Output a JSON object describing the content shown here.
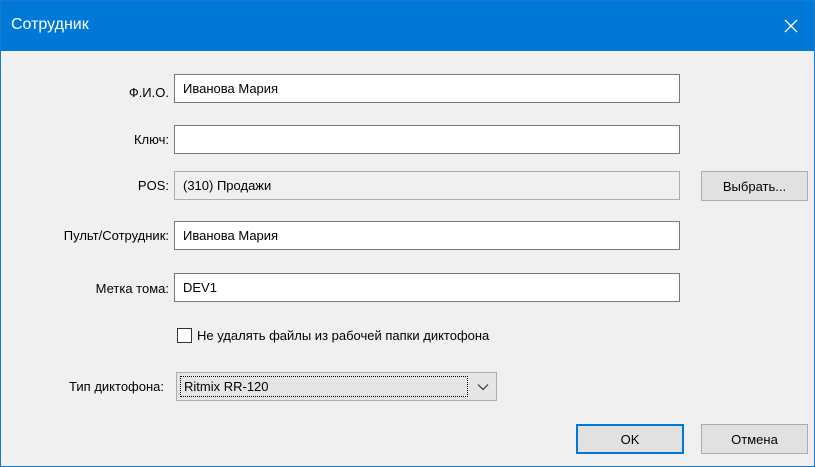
{
  "dialog": {
    "title": "Сотрудник",
    "close_icon": "close-icon"
  },
  "form": {
    "fio": {
      "label": "Ф.И.О.",
      "value": "Иванова Мария"
    },
    "key": {
      "label": "Ключ:",
      "value": ""
    },
    "pos": {
      "label": "POS:",
      "value": "(310) Продажи",
      "choose_label": "Выбрать..."
    },
    "remote": {
      "label": "Пульт/Сотрудник:",
      "value": "Иванова Мария"
    },
    "volume": {
      "label": "Метка тома:",
      "value": "DEV1"
    },
    "keep_files": {
      "label": "Не удалять файлы из рабочей папки диктофона",
      "checked": false
    },
    "recorder_type": {
      "label": "Тип диктофона:",
      "selected": "Ritmix RR-120"
    }
  },
  "buttons": {
    "ok": "OK",
    "cancel": "Отмена"
  },
  "colors": {
    "titlebar": "#0078d7",
    "default_button_border": "#0078d7",
    "dialog_background": "#f0f0f0"
  }
}
